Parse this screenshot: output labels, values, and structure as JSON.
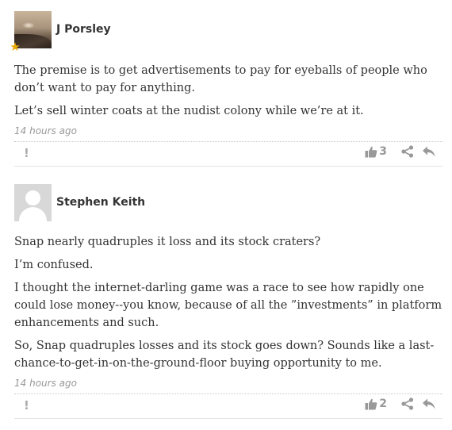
{
  "comments": [
    {
      "username": "J Porsley",
      "paragraphs": [
        "The premise is to get advertisements to pay for eyeballs of people who don’t want to pay for anything.",
        "Let’s sell winter coats at the nudist colony while we’re at it."
      ],
      "timestamp": "14 hours ago",
      "flag_label": "!",
      "like_count": "3",
      "icons": [
        "flag-icon",
        "thumbs-up-icon",
        "share-icon",
        "reply-icon",
        "star-icon"
      ]
    },
    {
      "username": "Stephen Keith",
      "paragraphs": [
        "Snap nearly quadruples it loss and its stock craters?",
        "I’m confused.",
        "I thought the internet-darling game was a race to see how rapidly one could lose money--you know, because of all the ”investments” in platform enhancements and such.",
        "So, Snap quadruples losses and its stock goes down? Sounds like a last-chance-to-get-in-on-the-ground-floor buying opportunity to me."
      ],
      "timestamp": "14 hours ago",
      "flag_label": "!",
      "like_count": "2",
      "icons": [
        "flag-icon",
        "thumbs-up-icon",
        "share-icon",
        "reply-icon"
      ]
    }
  ],
  "colors": {
    "text": "#333333",
    "muted": "#999999",
    "star": "#e9a800"
  }
}
